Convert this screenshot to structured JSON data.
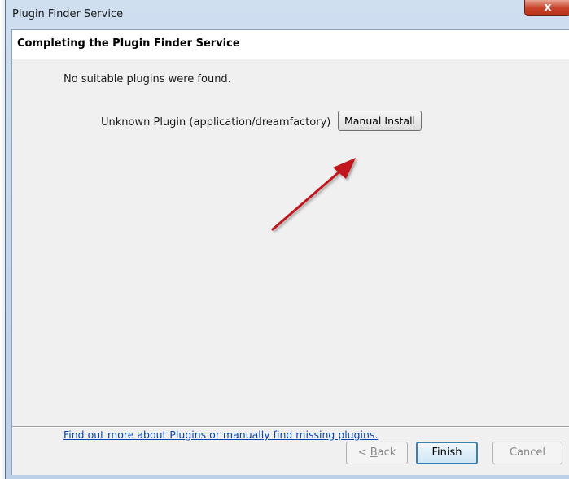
{
  "window": {
    "title": "Plugin Finder Service",
    "close_glyph": "x"
  },
  "header": {
    "title": "Completing the Plugin Finder Service"
  },
  "content": {
    "message": "No suitable plugins were found.",
    "plugin_name": "Unknown Plugin (application/dreamfactory)",
    "manual_install_label": "Manual Install",
    "link_text": "Find out more about Plugins or manually find missing plugins."
  },
  "footer": {
    "back_prefix": "< ",
    "back_accel": "B",
    "back_rest": "ack",
    "finish_label": "Finish",
    "cancel_label": "Cancel"
  },
  "colors": {
    "annotation_arrow": "#c0171c",
    "link": "#0645ad",
    "close_button": "#c9442b"
  },
  "icons": {
    "close": "close-icon",
    "annotation": "red-arrow-icon"
  }
}
